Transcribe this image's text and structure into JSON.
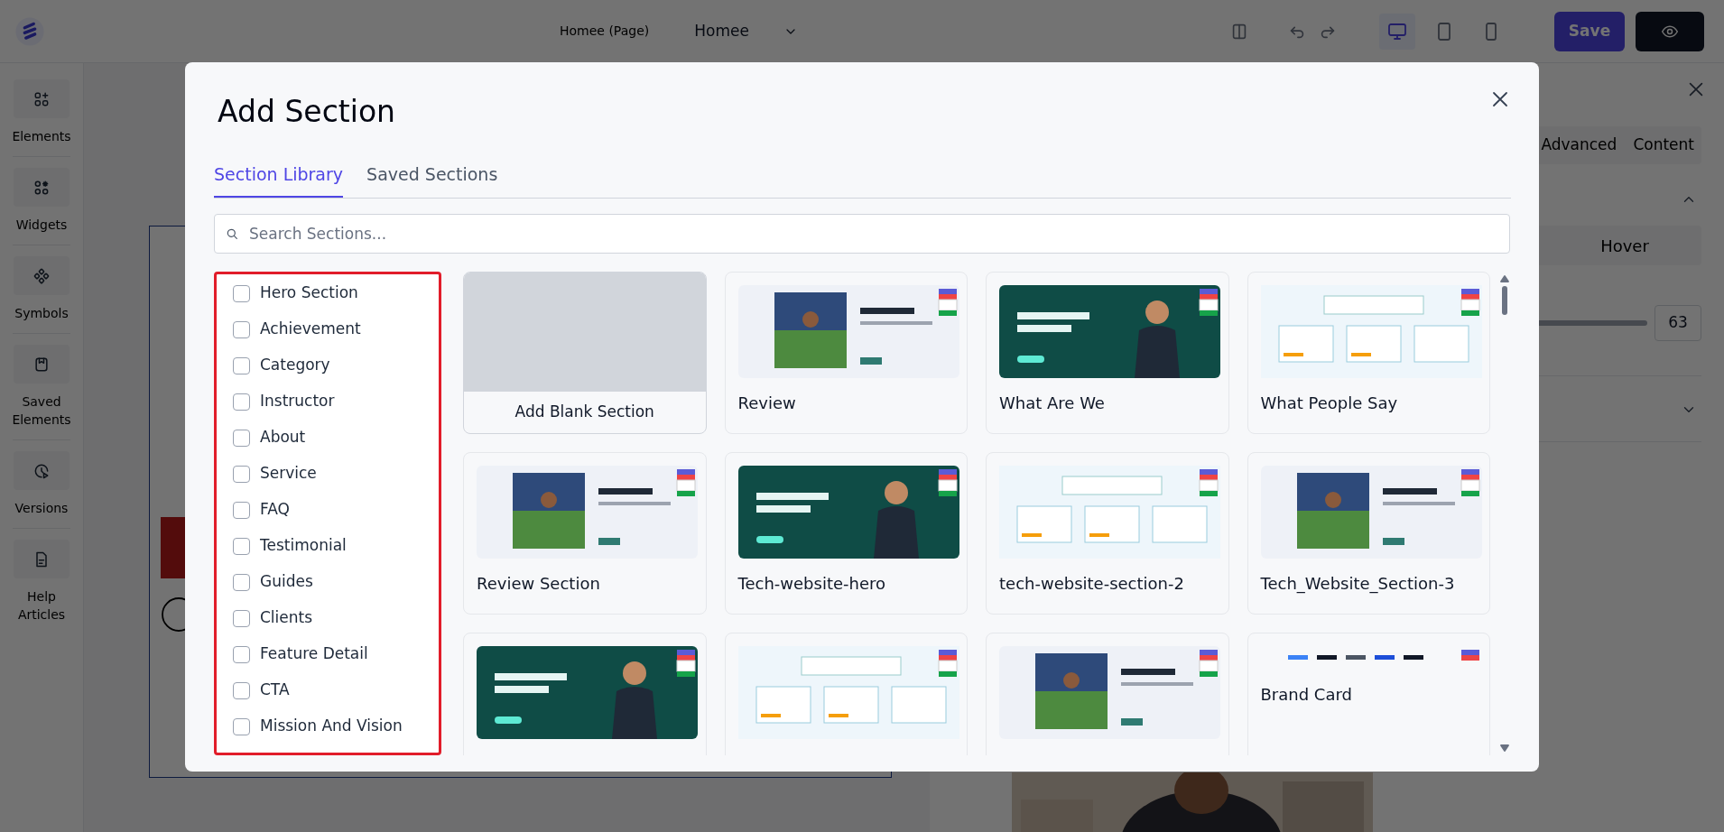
{
  "topbar": {
    "page_label": "Homee (Page)",
    "page_name": "Homee",
    "save": "Save"
  },
  "sidebar": [
    {
      "label": "Elements",
      "kind": "elements"
    },
    {
      "label": "Widgets",
      "kind": "widgets"
    },
    {
      "label": "Symbols",
      "kind": "symbols"
    },
    {
      "label": "Saved Elements",
      "kind": "saved"
    },
    {
      "label": "Versions",
      "kind": "versions"
    },
    {
      "label": "Help Articles",
      "kind": "help"
    }
  ],
  "inspector": {
    "tabs": [
      {
        "label": "Advanced",
        "selected": false
      },
      {
        "label": "Content",
        "selected": false
      }
    ],
    "state_tabs": [
      {
        "label": "Hover",
        "selected": false
      }
    ],
    "value": "63"
  },
  "modal": {
    "title": "Add Section",
    "tabs": [
      {
        "label": "Section Library",
        "selected": true
      },
      {
        "label": "Saved Sections",
        "selected": false
      }
    ],
    "search": {
      "placeholder": "Search Sections..."
    },
    "categories": [
      {
        "label": "Hero Section",
        "checked": false
      },
      {
        "label": "Achievement",
        "checked": false
      },
      {
        "label": "Category",
        "checked": false
      },
      {
        "label": "Instructor",
        "checked": false
      },
      {
        "label": "About",
        "checked": false
      },
      {
        "label": "Service",
        "checked": false
      },
      {
        "label": "FAQ",
        "checked": false
      },
      {
        "label": "Testimonial",
        "checked": false
      },
      {
        "label": "Guides",
        "checked": false
      },
      {
        "label": "Clients",
        "checked": false
      },
      {
        "label": "Feature Detail",
        "checked": false
      },
      {
        "label": "CTA",
        "checked": false
      },
      {
        "label": "Mission And Vision",
        "checked": false
      }
    ],
    "cards": [
      {
        "kind": "blank",
        "title": "Add Blank Section"
      },
      {
        "kind": "template",
        "title": "Review"
      },
      {
        "kind": "template",
        "title": "What Are We"
      },
      {
        "kind": "template",
        "title": "What People Say"
      },
      {
        "kind": "template",
        "title": "Review Section"
      },
      {
        "kind": "template",
        "title": "Tech-website-hero"
      },
      {
        "kind": "template",
        "title": "tech-website-section-2"
      },
      {
        "kind": "template",
        "title": "Tech_Website_Section-3"
      },
      {
        "kind": "template"
      },
      {
        "kind": "template"
      },
      {
        "kind": "template"
      },
      {
        "kind": "strip",
        "title": "Brand Card"
      }
    ]
  }
}
